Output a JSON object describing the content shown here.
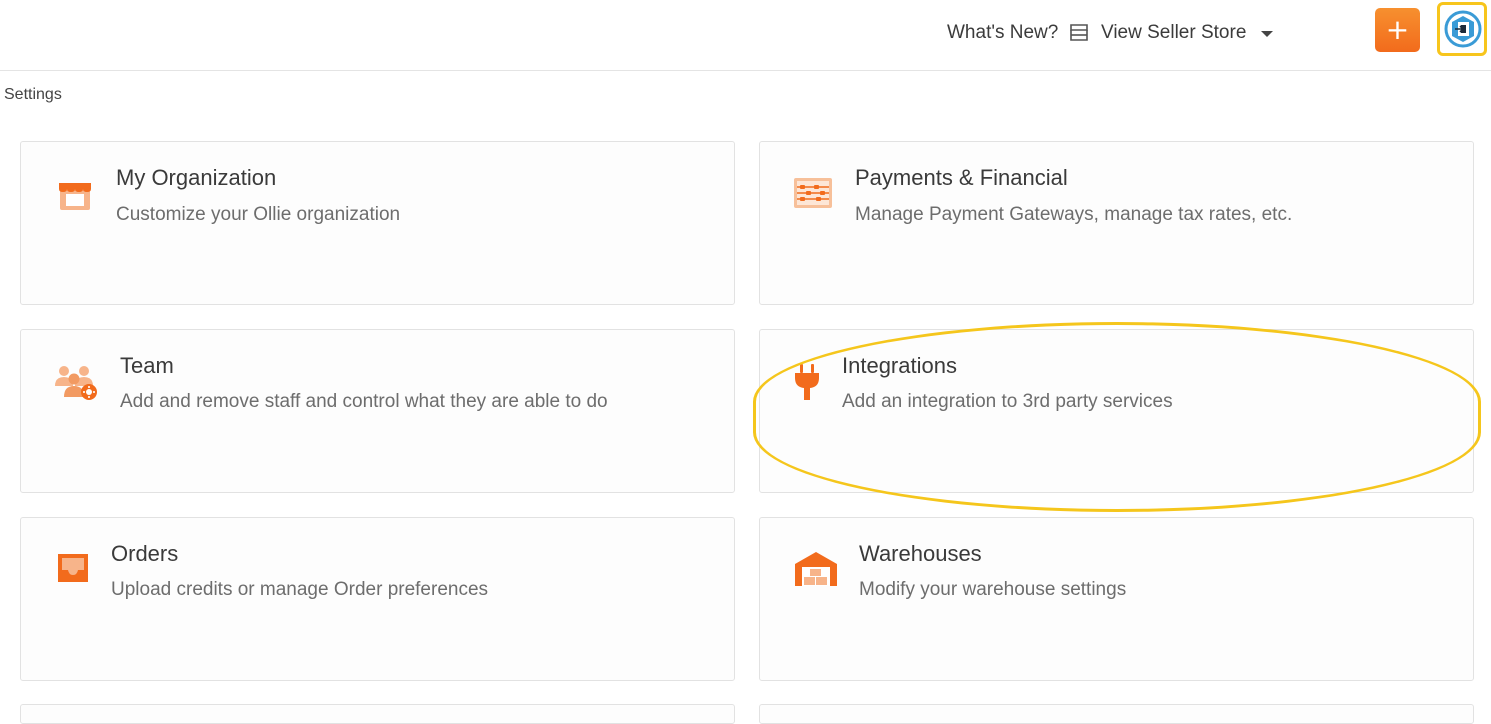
{
  "header": {
    "whats_new": "What's New?",
    "view_store": "View Seller Store"
  },
  "breadcrumb": "Settings",
  "cards": [
    {
      "title": "My Organization",
      "desc": "Customize your Ollie organization",
      "icon": "storefront-icon"
    },
    {
      "title": "Payments & Financial",
      "desc": "Manage Payment Gateways, manage tax rates, etc.",
      "icon": "abacus-icon"
    },
    {
      "title": "Team",
      "desc": "Add and remove staff and control what they are able to do",
      "icon": "team-settings-icon"
    },
    {
      "title": "Integrations",
      "desc": "Add an integration to 3rd party services",
      "icon": "plug-icon"
    },
    {
      "title": "Orders",
      "desc": "Upload credits or manage Order preferences",
      "icon": "inbox-tray-icon"
    },
    {
      "title": "Warehouses",
      "desc": "Modify your warehouse settings",
      "icon": "warehouse-icon"
    }
  ],
  "colors": {
    "accent": "#f26b1c",
    "accent_light": "#f7b48a",
    "highlight": "#f5c61c",
    "avatar": "#3a9bd6"
  }
}
